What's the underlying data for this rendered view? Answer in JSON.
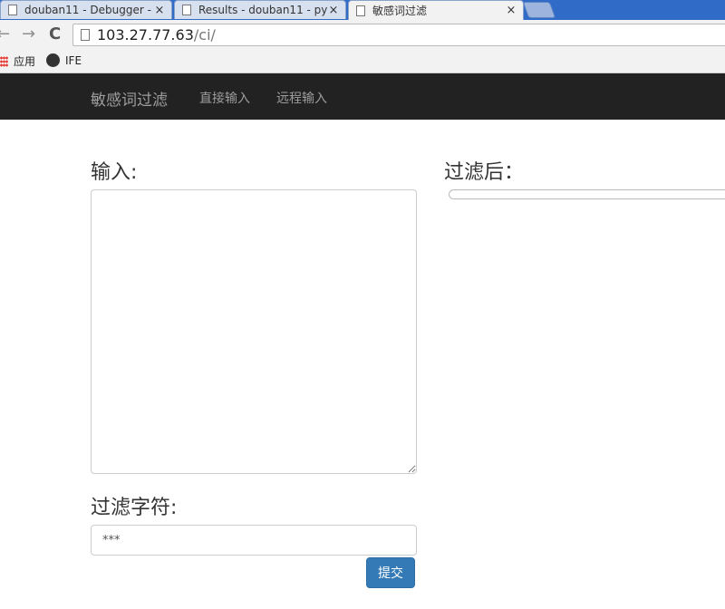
{
  "browser": {
    "tabs": [
      {
        "title": "douban11 - Debugger - ",
        "close": "×"
      },
      {
        "title": "Results - douban11 - py",
        "close": "×"
      },
      {
        "title": "敏感词过滤",
        "close": "×"
      }
    ],
    "active_tab": 2,
    "back_glyph": "←",
    "forward_glyph": "→",
    "reload_glyph": "C",
    "url_host": "103.27.77.63",
    "url_path": "/ci/",
    "bookmarks": [
      {
        "label": "应用",
        "icon": "apps-grid-icon"
      },
      {
        "label": "IFE",
        "icon": "ife-logo-icon"
      }
    ]
  },
  "navbar": {
    "brand": "敏感词过滤",
    "links": [
      "直接输入",
      "远程输入"
    ]
  },
  "form": {
    "input_label": "输入:",
    "input_value": "",
    "output_label": "过滤后：",
    "filter_label": "过滤字符:",
    "filter_value": "***",
    "submit_label": "提交"
  },
  "colors": {
    "navbar_bg": "#222222",
    "nav_text": "#9d9d9d",
    "primary_button": "#337ab7",
    "tabstrip": "#2f6bc7"
  }
}
